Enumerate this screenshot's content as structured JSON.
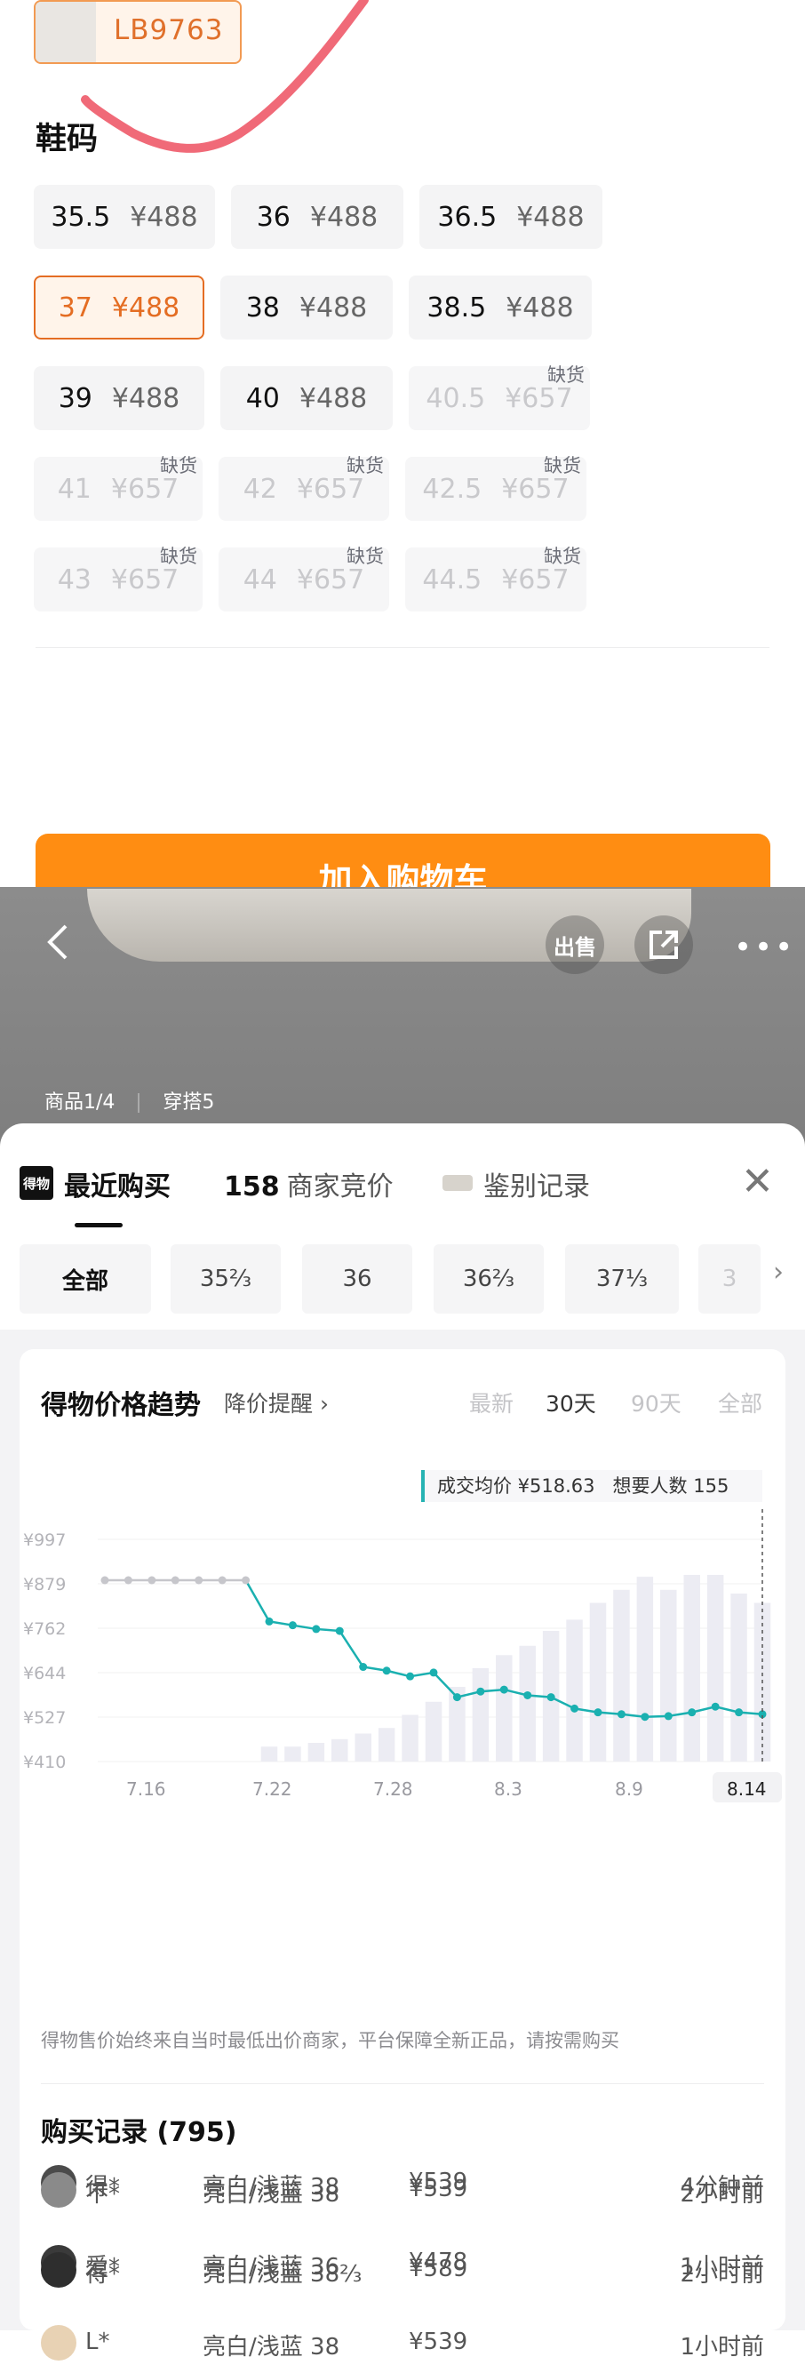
{
  "sku": {
    "code": "LB9763"
  },
  "size_title": "鞋码",
  "sizes": [
    {
      "size": "35.5",
      "price": "¥488"
    },
    {
      "size": "36",
      "price": "¥488"
    },
    {
      "size": "36.5",
      "price": "¥488"
    },
    {
      "size": "37",
      "price": "¥488"
    },
    {
      "size": "38",
      "price": "¥488"
    },
    {
      "size": "38.5",
      "price": "¥488"
    },
    {
      "size": "39",
      "price": "¥488"
    },
    {
      "size": "40",
      "price": "¥488"
    },
    {
      "size": "40.5",
      "price": "¥657"
    },
    {
      "size": "41",
      "price": "¥657"
    },
    {
      "size": "42",
      "price": "¥657"
    },
    {
      "size": "42.5",
      "price": "¥657"
    },
    {
      "size": "43",
      "price": "¥657"
    },
    {
      "size": "44",
      "price": "¥657"
    },
    {
      "size": "44.5",
      "price": "¥657"
    }
  ],
  "out_of_stock_label": "缺货",
  "add_to_cart": "加入购物车",
  "overlay": {
    "sell_label": "出售",
    "tag1": "商品1/4",
    "tag2": "穿搭5"
  },
  "tabs": {
    "recent": "最近购买",
    "bid_count": "158",
    "bid": "商家竞价",
    "auth": "鉴别记录",
    "logo": "得物"
  },
  "filters": [
    "全部",
    "35⅔",
    "36",
    "36⅔",
    "37⅓",
    "3"
  ],
  "trend": {
    "title": "得物价格趋势",
    "remind": "降价提醒 ›",
    "ranges": [
      "最新",
      "30天",
      "90天",
      "全部"
    ],
    "avg_label": "成交均价 ¥518.63",
    "want_label": "想要人数 155",
    "note": "得物售价始终来自当时最低出价商家，平台保障全新正品，请按需购买"
  },
  "chart_data": {
    "type": "line",
    "yticks": [
      "¥997",
      "¥879",
      "¥762",
      "¥644",
      "¥527",
      "¥410"
    ],
    "xticks": [
      "7.16",
      "7.22",
      "7.28",
      "8.3",
      "8.9",
      "8.14"
    ],
    "ylim": [
      410,
      997
    ],
    "series": [
      {
        "values": [
          889,
          889,
          889,
          889,
          889,
          889,
          889,
          780,
          770,
          760,
          755,
          660,
          650,
          635,
          645,
          580,
          595,
          600,
          585,
          580,
          550,
          540,
          535,
          528,
          530,
          540,
          555,
          540,
          535
        ]
      }
    ],
    "volume": [
      0,
      0,
      0,
      0,
      0,
      0,
      0,
      8,
      8,
      10,
      12,
      15,
      18,
      25,
      32,
      40,
      50,
      57,
      62,
      70,
      76,
      85,
      92,
      99,
      92,
      100,
      100,
      90,
      85
    ]
  },
  "records": {
    "title": "购买记录 (795)",
    "rows": [
      {
        "name": "得*",
        "spec": "亮白/浅蓝 38",
        "price": "¥539",
        "time": "4分钟前"
      },
      {
        "name": "爱*",
        "spec": "亮白/浅蓝 36",
        "price": "¥478",
        "time": "1小时前"
      },
      {
        "name": "L*",
        "spec": "亮白/浅蓝 38",
        "price": "¥539",
        "time": "1小时前"
      },
      {
        "name": "不*",
        "spec": "亮白/浅蓝 38",
        "price": "¥539",
        "time": "2小时前"
      },
      {
        "name": "得*",
        "spec": "亮白/浅蓝 38⅔",
        "price": "¥589",
        "time": "2小时前"
      }
    ]
  }
}
